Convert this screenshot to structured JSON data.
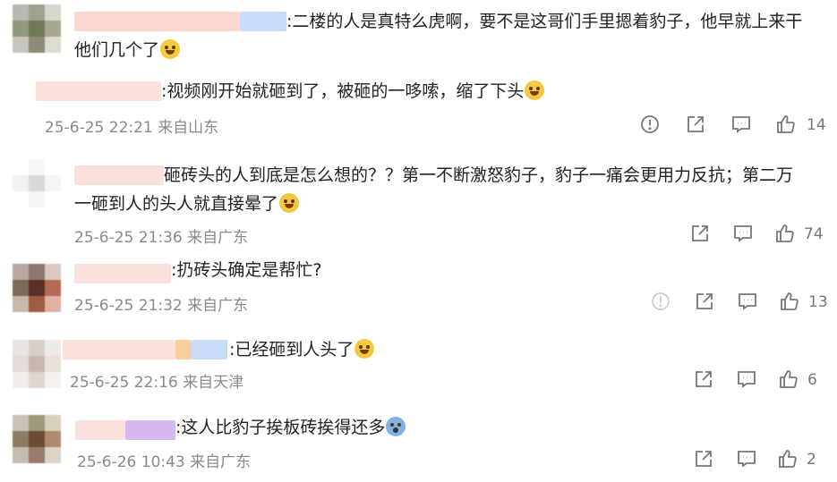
{
  "comments": [
    {
      "text_line1": ":二楼的人是真特么虎啊，要不是这哥们手里摁着豹子，他早就上来干",
      "text_line2": "他们几个了",
      "emoji": "laughing-crying-emoji"
    },
    {
      "text_line1": ":视频刚开始就砸到了，被砸的一哆嗦，缩了下头",
      "emoji": "laughing-crying-emoji",
      "timestamp": "25-6-25 22:21",
      "location": "来自山东",
      "likes": "14"
    },
    {
      "text_line1": "砸砖头的人到底是怎么想的？？第一不断激怒豹子，豹子一痛会更用力反抗；第二万",
      "text_line2": "一砸到人的头人就直接晕了",
      "emoji": "laughing-crying-emoji",
      "timestamp": "25-6-25 21:36",
      "location": "来自广东",
      "likes": "74"
    },
    {
      "text_line1": ":扔砖头确定是帮忙?",
      "timestamp": "25-6-25 21:32",
      "location": "来自广东",
      "likes": "13"
    },
    {
      "text_line1": ":已经砸到人头了",
      "emoji": "thinking-emoji",
      "timestamp": "25-6-25 22:16",
      "location": "来自天津",
      "likes": "6"
    },
    {
      "text_line1": ":这人比豹子挨板砖挨得还多",
      "emoji": "shocked-emoji",
      "timestamp": "25-6-26 10:43",
      "location": "来自广东",
      "likes": "2"
    }
  ],
  "icons": {
    "report": "exclamation-circle-icon",
    "share": "share-icon",
    "comment": "comment-icon",
    "like": "thumbs-up-icon"
  },
  "colors": {
    "text": "#222222",
    "meta": "#8a8a8a",
    "icon": "#777777",
    "name_blur": "#f9d6cf",
    "name_blur_blue": "#c9dcf7",
    "name_blur_purple": "#d6b8ef"
  }
}
